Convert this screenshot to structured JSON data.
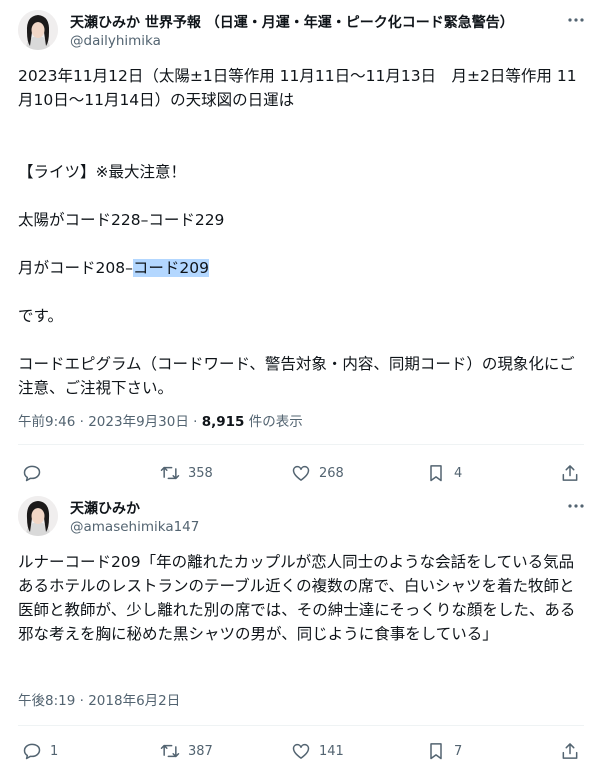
{
  "tweets": [
    {
      "user": {
        "name": "天瀬ひみか 世界予報 （日運・月運・年運・ピーク化コード緊急警告）",
        "handle": "@dailyhimika"
      },
      "body": {
        "line1": "2023年11月12日（太陽±1日等作用 11月11日〜11月13日　月±2日等作用 11月10日〜11月14日）の天球図の日運は",
        "line2": "【ライツ】※最大注意！",
        "line3": "太陽がコード228–コード229",
        "line4_prefix": "月がコード208–",
        "line4_highlight": "コード209",
        "line5": "です。",
        "line6": "コードエピグラム（コードワード、警告対象・内容、同期コード）の現象化にご注意、ご注視下さい。"
      },
      "meta": {
        "time": "午前9:46",
        "date": "2023年9月30日",
        "views": "8,915",
        "views_suffix": "件の表示"
      },
      "actions": {
        "replies": "",
        "retweets": "358",
        "likes": "268",
        "bookmarks": "4"
      }
    },
    {
      "user": {
        "name": "天瀬ひみか",
        "handle": "@amasehimika147"
      },
      "body": {
        "text": "ルナーコード209「年の離れたカップルが恋人同士のような会話をしている気品あるホテルのレストランのテーブル近くの複数の席で、白いシャツを着た牧師と医師と教師が、少し離れた別の席では、その紳士達にそっくりな顔をした、ある邪な考えを胸に秘めた黒シャツの男が、同じように食事をしている」"
      },
      "meta": {
        "time": "午後8:19",
        "date": "2018年6月2日"
      },
      "actions": {
        "replies": "1",
        "retweets": "387",
        "likes": "141",
        "bookmarks": "7"
      }
    }
  ],
  "icons": {
    "more": "more-icon",
    "reply": "reply-icon",
    "retweet": "retweet-icon",
    "like": "heart-icon",
    "bookmark": "bookmark-icon",
    "share": "share-icon"
  },
  "colors": {
    "text": "#0f1419",
    "secondary": "#536471",
    "highlight": "#b3d7ff",
    "divider": "#eff3f4"
  }
}
